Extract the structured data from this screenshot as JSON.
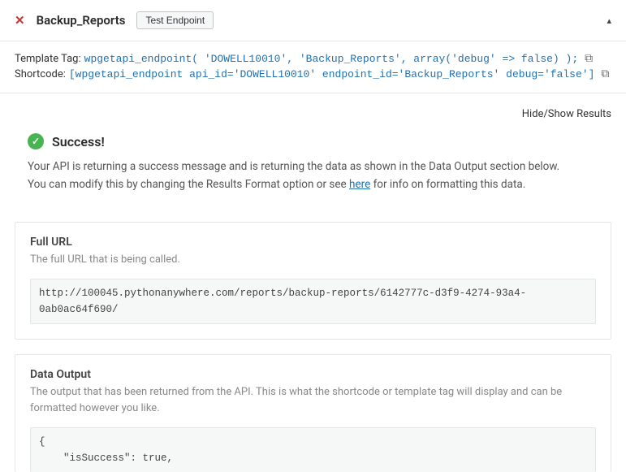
{
  "header": {
    "close_symbol": "✕",
    "title": "Backup_Reports",
    "test_button": "Test Endpoint",
    "collapse_symbol": "▴"
  },
  "tags": {
    "template_label": "Template Tag:",
    "template_code": "wpgetapi_endpoint( 'DOWELL10010', 'Backup_Reports', array('debug' => false) );",
    "shortcode_label": "Shortcode:",
    "shortcode_code": "[wpgetapi_endpoint api_id='DOWELL10010' endpoint_id='Backup_Reports' debug='false']",
    "copy_glyph": "⧉"
  },
  "results_toggle": "Hide/Show Results",
  "success": {
    "check": "✓",
    "title": "Success!",
    "line1": "Your API is returning a success message and is returning the data as shown in the Data Output section below.",
    "line2_before": "You can modify this by changing the Results Format option or see ",
    "here": "here",
    "line2_after": " for info on formatting this data."
  },
  "full_url_card": {
    "title": "Full URL",
    "subtitle": "The full URL that is being called.",
    "url": "http://100045.pythonanywhere.com/reports/backup-reports/6142777c-d3f9-4274-93a4-0ab0ac64f690/"
  },
  "data_output_card": {
    "title": "Data Output",
    "subtitle": "The output that has been returned from the API. This is what the shortcode or template tag will display and can be formatted however you like.",
    "content": "{\n    \"isSuccess\": true,"
  }
}
